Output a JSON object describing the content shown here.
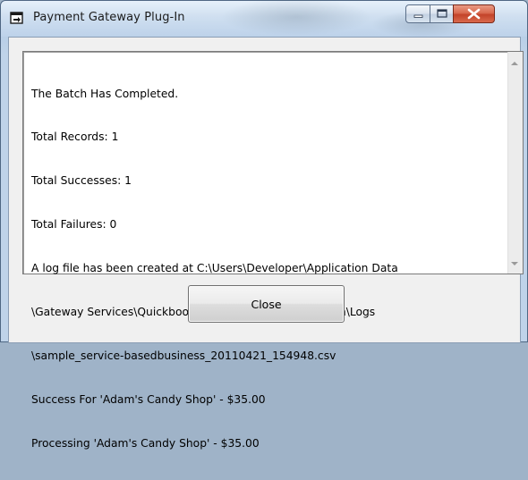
{
  "window": {
    "title": "Payment Gateway Plug-In",
    "icon": "app-window-icon",
    "controls": {
      "minimize": "minimize-icon",
      "maximize": "maximize-icon",
      "close": "close-icon"
    }
  },
  "log": {
    "lines": [
      "The Batch Has Completed.",
      "Total Records: 1",
      "Total Successes: 1",
      "Total Failures: 0",
      "A log file has been created at C:\\Users\\Developer\\Application Data",
      "\\Gateway Services\\Quickbooks Payment Gateway Plug-In\\Logs",
      "\\sample_service-basedbusiness_20110421_154948.csv",
      "Success For 'Adam's Candy Shop' - $35.00",
      "Processing 'Adam's Candy Shop' - $35.00"
    ]
  },
  "buttons": {
    "close_label": "Close"
  },
  "colors": {
    "close_button_red": "#c3432a",
    "titlebar_blue": "#bdd2ea"
  }
}
